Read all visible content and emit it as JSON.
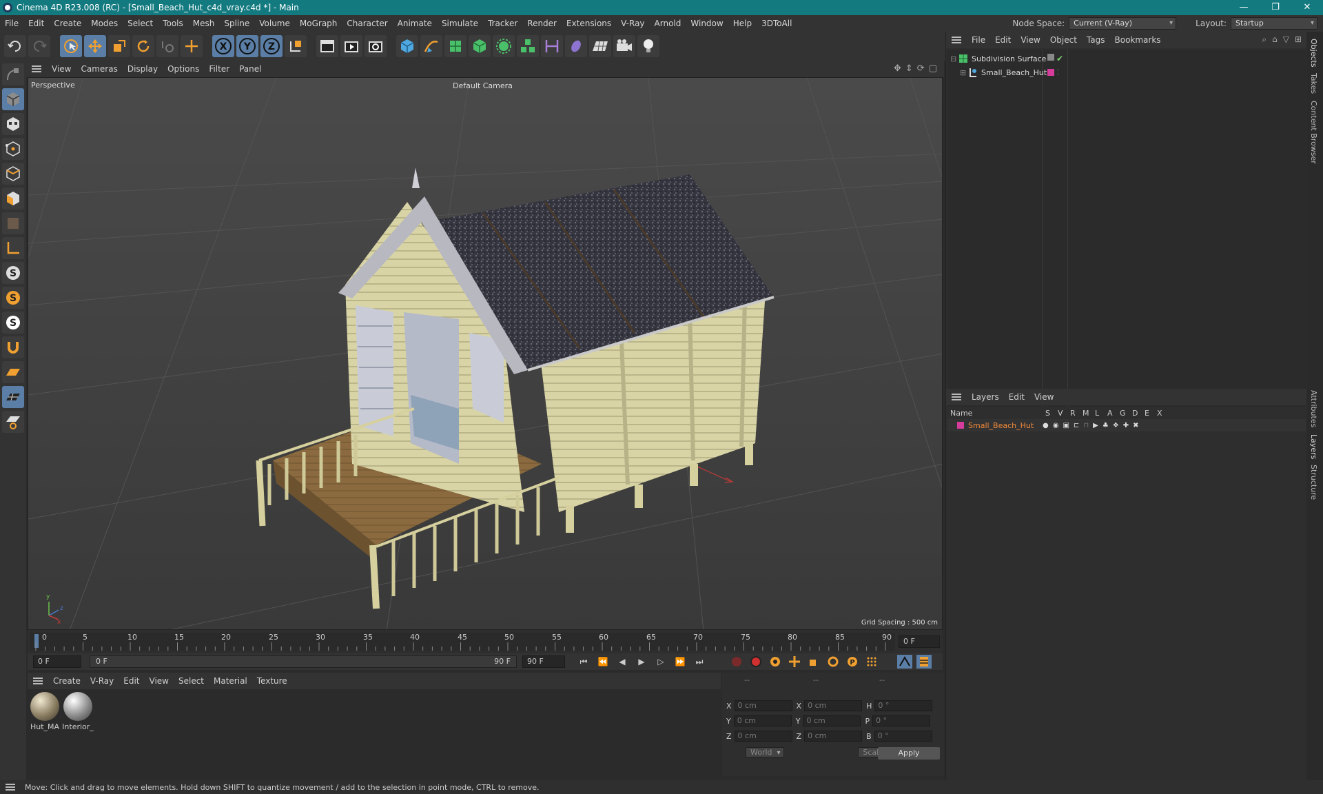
{
  "window": {
    "title": "Cinema 4D R23.008 (RC) - [Small_Beach_Hut_c4d_vray.c4d *] - Main",
    "controls": [
      "—",
      "❐",
      "✕"
    ]
  },
  "menubar": {
    "items": [
      "File",
      "Edit",
      "Create",
      "Modes",
      "Select",
      "Tools",
      "Mesh",
      "Spline",
      "Volume",
      "MoGraph",
      "Character",
      "Animate",
      "Simulate",
      "Tracker",
      "Render",
      "Extensions",
      "V-Ray",
      "Arnold",
      "Window",
      "Help",
      "3DToAll"
    ],
    "node_space_label": "Node Space:",
    "node_space_value": "Current (V-Ray)",
    "layout_label": "Layout:",
    "layout_value": "Startup"
  },
  "toolbar": {
    "axis_x": "X",
    "axis_y": "Y",
    "axis_z": "Z"
  },
  "viewport": {
    "menu": [
      "View",
      "Cameras",
      "Display",
      "Options",
      "Filter",
      "Panel"
    ],
    "view_name": "Perspective",
    "camera": "Default Camera",
    "grid_spacing": "Grid Spacing : 500 cm",
    "axis_y": "y",
    "axis_z": "z",
    "axis_x": "x"
  },
  "timeline": {
    "ticks": [
      "0",
      "5",
      "10",
      "15",
      "20",
      "25",
      "30",
      "35",
      "40",
      "45",
      "50",
      "55",
      "60",
      "65",
      "70",
      "75",
      "80",
      "85",
      "90"
    ],
    "current_frame": "0 F"
  },
  "transport": {
    "start": "0 F",
    "range_start": "0 F",
    "range_end": "90 F",
    "end": "90 F"
  },
  "materials": {
    "menu": [
      "Create",
      "V-Ray",
      "Edit",
      "View",
      "Select",
      "Material",
      "Texture"
    ],
    "items": [
      {
        "name": "Hut_MA",
        "color": "#8a7d62"
      },
      {
        "name": "Interior_",
        "color": "#8c8c8c"
      }
    ]
  },
  "coords": {
    "header": [
      "--",
      "--",
      "--"
    ],
    "rows": [
      {
        "l1": "X",
        "v1": "0 cm",
        "l2": "X",
        "v2": "0 cm",
        "l3": "H",
        "v3": "0 °"
      },
      {
        "l1": "Y",
        "v1": "0 cm",
        "l2": "Y",
        "v2": "0 cm",
        "l3": "P",
        "v3": "0 °"
      },
      {
        "l1": "Z",
        "v1": "0 cm",
        "l2": "Z",
        "v2": "0 cm",
        "l3": "B",
        "v3": "0 °"
      }
    ],
    "mode": "World",
    "transform": "Scale",
    "apply": "Apply"
  },
  "objects": {
    "menu": [
      "File",
      "Edit",
      "View",
      "Object",
      "Tags",
      "Bookmarks"
    ],
    "tree": [
      {
        "name": "Subdivision Surface",
        "color": "#7bd36b"
      },
      {
        "name": "Small_Beach_Hut",
        "color": "#d63c9c"
      }
    ]
  },
  "layers": {
    "menu": [
      "Layers",
      "Edit",
      "View"
    ],
    "columns": [
      "Name",
      "S",
      "V",
      "R",
      "M",
      "L",
      "A",
      "G",
      "D",
      "E",
      "X"
    ],
    "rows": [
      {
        "name": "Small_Beach_Hut",
        "color": "#d63c9c"
      }
    ]
  },
  "sidetabs": [
    "Objects",
    "Takes",
    "Content Browser",
    "Attributes",
    "Layers",
    "Structure"
  ],
  "status": "Move: Click and drag to move elements. Hold down SHIFT to quantize movement / add to the selection in point mode, CTRL to remove.",
  "colors": {
    "titlebar": "#137a80",
    "accent": "#5a7ea5",
    "orange": "#f0a030",
    "layer_name": "#f08a3a"
  }
}
